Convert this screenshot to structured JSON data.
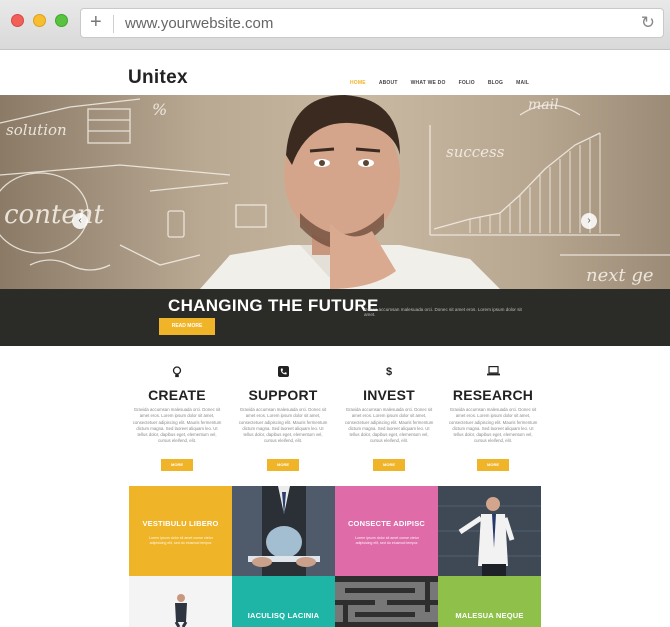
{
  "browser": {
    "url": "www.yourwebsite.com"
  },
  "site": {
    "logo": "Unitex",
    "nav": [
      "HOME",
      "ABOUT",
      "WHAT WE DO",
      "FOLIO",
      "BLOG",
      "MAIL"
    ]
  },
  "hero": {
    "chalk_words": [
      "solution",
      "%",
      "content",
      "success",
      "mail",
      "next ge"
    ],
    "caption_title": "CHANGING THE FUTURE",
    "caption_text": "Donec accumsan malesuada orci. Donec sit amet eros. Lorem ipsum dolor sit amet.",
    "button_label": "READ MORE"
  },
  "features": [
    {
      "icon": "lightbulb-icon",
      "title": "CREATE",
      "text": "Gravida accumsan malesuada orci. Donec sit amet eros. Lorem ipsum dolor sit amet, consectetuer adipiscing elit. Mauris fermentum dictum magna. Sed laoreet aliquam leo. Ut tellus dolor, dapibus eget, elementum vel, cursus eleifend, elit.",
      "button": "MORE"
    },
    {
      "icon": "phone-icon",
      "title": "SUPPORT",
      "text": "Gravida accumsan malesuada orci. Donec sit amet eros. Lorem ipsum dolor sit amet, consectetuer adipiscing elit. Mauris fermentum dictum magna. Sed laoreet aliquam leo. Ut tellus dolor, dapibus eget, elementum vel, cursus eleifend, elit.",
      "button": "MORE"
    },
    {
      "icon": "dollar-icon",
      "title": "INVEST",
      "text": "Gravida accumsan malesuada orci. Donec sit amet eros. Lorem ipsum dolor sit amet, consectetuer adipiscing elit. Mauris fermentum dictum magna. Sed laoreet aliquam leo. Ut tellus dolor, dapibus eget, elementum vel, cursus eleifend, elit.",
      "button": "MORE"
    },
    {
      "icon": "laptop-icon",
      "title": "RESEARCH",
      "text": "Gravida accumsan malesuada orci. Donec sit amet eros. Lorem ipsum dolor sit amet, consectetuer adipiscing elit. Mauris fermentum dictum magna. Sed laoreet aliquam leo. Ut tellus dolor, dapibus eget, elementum vel, cursus eleifend, elit.",
      "button": "MORE"
    }
  ],
  "grid": {
    "tile1": {
      "title": "VESTIBULU LIBERO",
      "text": "Lorem ipsum dolor sit amet conse ctetur adipisicing elit, sed do eiusmod tempor.",
      "color": "#f0b428"
    },
    "tile3": {
      "title": "CONSECTE ADIPISC",
      "text": "Lorem ipsum dolor sit amet conse ctetur adipisicing elit, sed do eiusmod tempor.",
      "color": "#df6ba8"
    },
    "tile6": {
      "title": "IACULISQ LACINIA",
      "color": "#1fb5a6"
    },
    "tile8": {
      "title": "MALESUA NEQUE",
      "color": "#8fc14a"
    }
  },
  "colors": {
    "accent": "#f0b428",
    "caption_bar": "#2b2b28",
    "pink": "#df6ba8",
    "teal": "#1fb5a6",
    "green": "#8fc14a"
  }
}
